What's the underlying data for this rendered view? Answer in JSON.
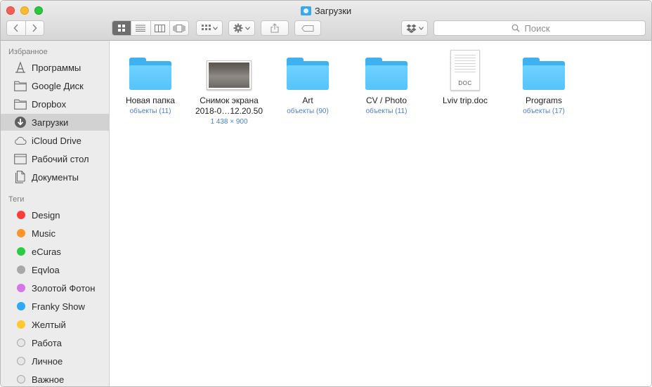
{
  "window": {
    "title": "Загрузки"
  },
  "search": {
    "placeholder": "Поиск"
  },
  "sidebar": {
    "favorites_header": "Избранное",
    "favorites": [
      {
        "label": "Программы",
        "icon": "applications-icon"
      },
      {
        "label": "Google Диск",
        "icon": "folder-icon"
      },
      {
        "label": "Dropbox",
        "icon": "folder-icon"
      },
      {
        "label": "Загрузки",
        "icon": "downloads-icon",
        "selected": true
      },
      {
        "label": "iCloud Drive",
        "icon": "cloud-icon"
      },
      {
        "label": "Рабочий стол",
        "icon": "desktop-icon"
      },
      {
        "label": "Документы",
        "icon": "documents-icon"
      }
    ],
    "tags_header": "Теги",
    "tags": [
      {
        "label": "Design",
        "color": "#fc3d39"
      },
      {
        "label": "Music",
        "color": "#fd9426"
      },
      {
        "label": "eCuras",
        "color": "#28cd41"
      },
      {
        "label": "Eqvloa",
        "color": "#a8a8a8"
      },
      {
        "label": "Золотой Фотон",
        "color": "#d774e8"
      },
      {
        "label": "Franky Show",
        "color": "#2fa8f5"
      },
      {
        "label": "Желтый",
        "color": "#fdc92d"
      },
      {
        "label": "Работа",
        "color": "#e6e6e6"
      },
      {
        "label": "Личное",
        "color": "#e6e6e6"
      },
      {
        "label": "Важное",
        "color": "#e6e6e6"
      }
    ]
  },
  "files": [
    {
      "name": "Новая папка",
      "name2": "",
      "meta": "объекты (11)",
      "kind": "folder"
    },
    {
      "name": "Снимок экрана",
      "name2": "2018-0…12.20.50",
      "meta": "1 438 × 900",
      "kind": "image"
    },
    {
      "name": "Art",
      "name2": "",
      "meta": "объекты (90)",
      "kind": "folder"
    },
    {
      "name": "CV / Photo",
      "name2": "",
      "meta": "объекты (11)",
      "kind": "folder"
    },
    {
      "name": "Lviv trip.doc",
      "name2": "",
      "meta": "",
      "kind": "doc",
      "badge": "DOC"
    },
    {
      "name": "Programs",
      "name2": "",
      "meta": "объекты (17)",
      "kind": "folder"
    }
  ]
}
